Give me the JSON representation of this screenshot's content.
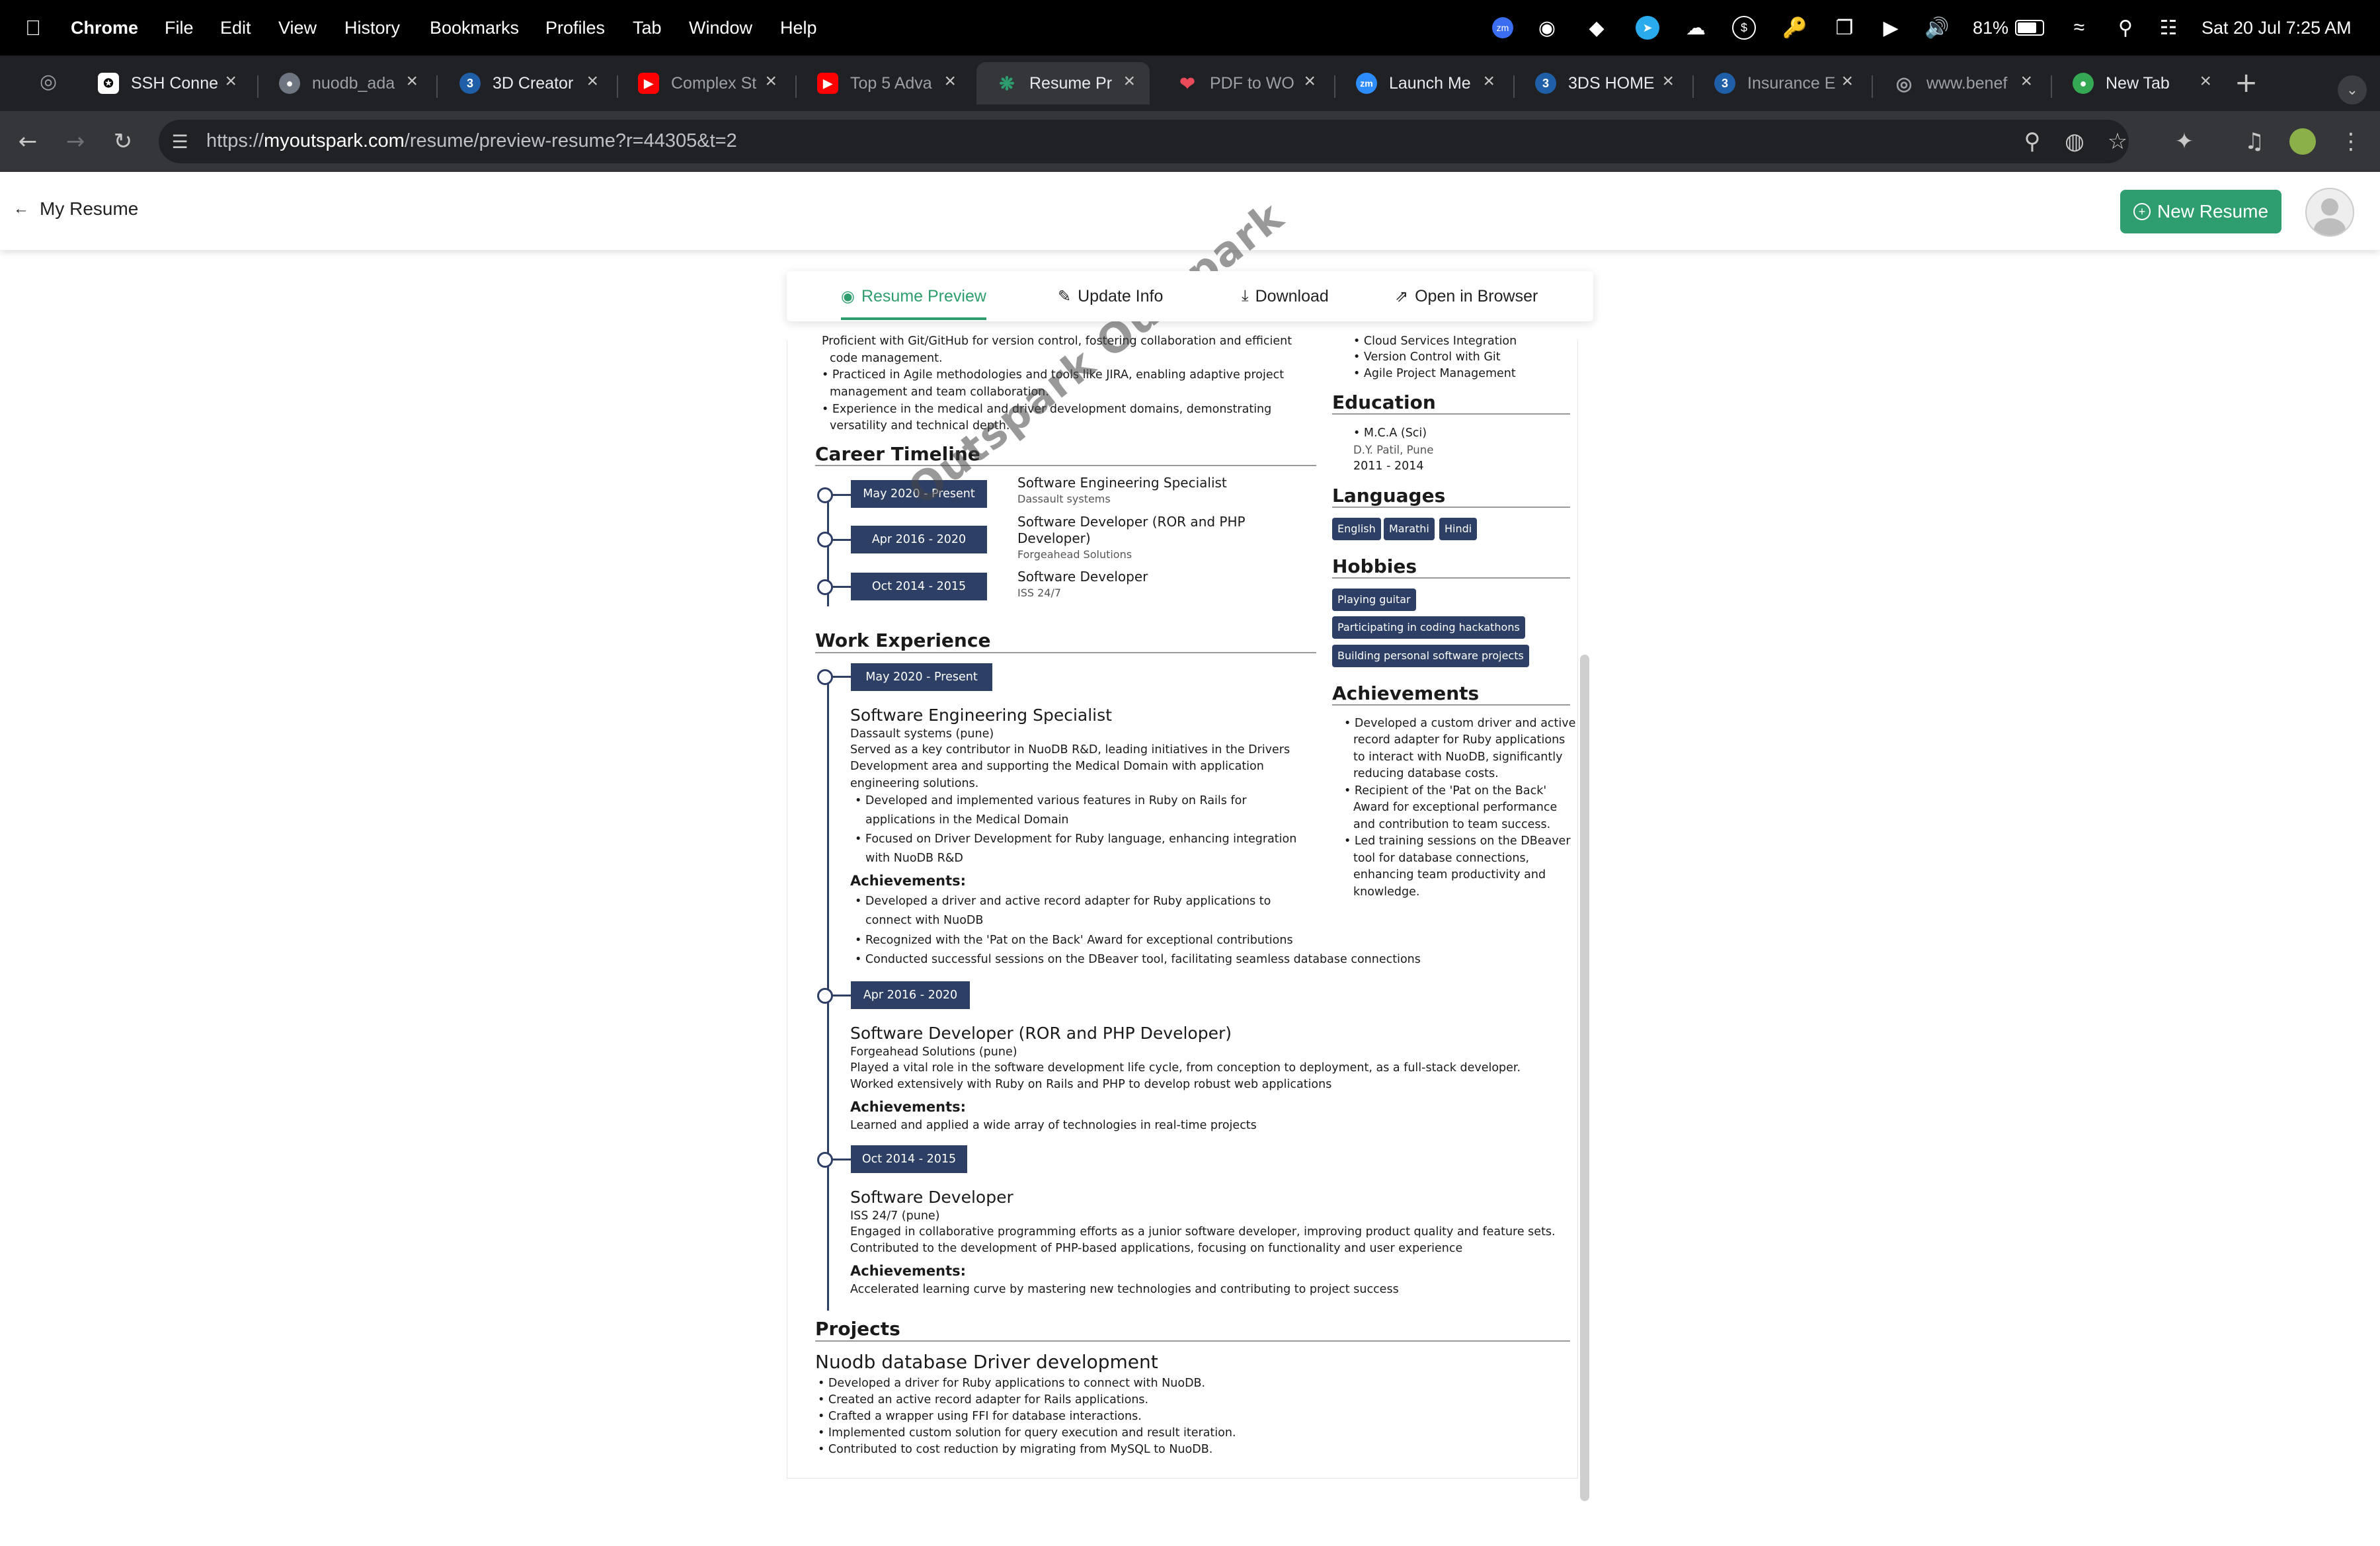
{
  "menubar": {
    "app": "Chrome",
    "items": [
      "File",
      "Edit",
      "View",
      "History",
      "Bookmarks",
      "Profiles",
      "Tab",
      "Window",
      "Help"
    ],
    "battery": "81%",
    "datetime": "Sat 20 Jul  7:25 AM"
  },
  "tabs": [
    {
      "title": "SSH Conne",
      "icon": "openai-icon",
      "color": "#ffffff"
    },
    {
      "title": "nuodb_ada",
      "icon": "github-icon",
      "color": "#6e7681"
    },
    {
      "title": "3D Creator",
      "icon": "3ds-icon",
      "color": "#1f5fa8"
    },
    {
      "title": "Complex St",
      "icon": "youtube-icon",
      "color": "#ff0000"
    },
    {
      "title": "Top 5 Adva",
      "icon": "youtube-icon",
      "color": "#ff0000"
    },
    {
      "title": "Resume Pr",
      "icon": "outspark-icon",
      "color": "#2e9e6e"
    },
    {
      "title": "PDF to WO",
      "icon": "pdf-heart-icon",
      "color": "#e94b5b"
    },
    {
      "title": "Launch Me",
      "icon": "zoom-icon",
      "color": "#2d8cff"
    },
    {
      "title": "3DS HOME",
      "icon": "3ds-icon",
      "color": "#1f5fa8"
    },
    {
      "title": "Insurance E",
      "icon": "3ds-icon",
      "color": "#1f5fa8"
    },
    {
      "title": "www.benef",
      "icon": "globe-icon",
      "color": "#9aa0a6"
    },
    {
      "title": "New Tab",
      "icon": "chrome-icon",
      "color": "#34a853"
    }
  ],
  "address": {
    "prefix": "https://",
    "host": "myoutspark.com",
    "path": "/resume/preview-resume?r=44305&t=2"
  },
  "app": {
    "back_label": "My Resume",
    "new_resume_label": "New Resume"
  },
  "actions": {
    "preview": "Resume Preview",
    "update": "Update Info",
    "download": "Download",
    "open": "Open in Browser"
  },
  "resume": {
    "watermark": "Outspark Outspark",
    "skills_tail": [
      "Proficient with Git/GitHub for version control, fostering collaboration and efficient",
      "code management.",
      "Practiced in Agile methodologies and tools like JIRA, enabling adaptive project",
      "management and team collaboration.",
      "Experience in the medical and driver development domains, demonstrating",
      "versatility and technical depth."
    ],
    "career_timeline_title": "Career Timeline",
    "timeline": [
      {
        "date": "May 2020 - Present",
        "title": "Software Engineering Specialist",
        "company": "Dassault systems"
      },
      {
        "date": "Apr 2016 - 2020",
        "title": "Software Developer (ROR and PHP",
        "title2": "Developer)",
        "company": "Forgeahead Solutions"
      },
      {
        "date": "Oct 2014 - 2015",
        "title": "Software Developer",
        "company": "ISS 24/7"
      }
    ],
    "work_title": "Work Experience",
    "jobs": [
      {
        "date": "May 2020 - Present",
        "title": "Software Engineering Specialist",
        "company": "Dassault systems (pune)",
        "summary": [
          "Served as a key contributor in NuoDB R&D, leading initiatives in the Drivers",
          "Development area and supporting the Medical Domain with application",
          "engineering solutions."
        ],
        "bullets": [
          "Developed and implemented various features in Ruby on Rails for",
          "applications in the Medical Domain",
          "Focused on Driver Development for Ruby language, enhancing integration",
          "with NuoDB R&D"
        ],
        "ach_label": "Achievements:",
        "achievements": [
          "Developed a driver and active record adapter for Ruby applications to",
          "connect with NuoDB",
          "Recognized with the 'Pat on the Back' Award for exceptional contributions",
          "Conducted successful sessions on the DBeaver tool, facilitating seamless database connections"
        ]
      },
      {
        "date": "Apr 2016 - 2020",
        "title": "Software Developer (ROR and PHP Developer)",
        "company": "Forgeahead Solutions (pune)",
        "summary": [
          "Played a vital role in the software development life cycle, from conception to deployment, as a full-stack developer.",
          "Worked extensively with Ruby on Rails and PHP to develop robust web applications"
        ],
        "ach_label": "Achievements:",
        "achievements": [
          "Learned and applied a wide array of technologies in real-time projects"
        ]
      },
      {
        "date": "Oct 2014 - 2015",
        "title": "Software Developer",
        "company": "ISS 24/7 (pune)",
        "summary": [
          "Engaged in collaborative programming efforts as a junior software developer, improving product quality and feature sets.",
          "Contributed to the development of PHP-based applications, focusing on functionality and user experience"
        ],
        "ach_label": "Achievements:",
        "achievements": [
          "Accelerated learning curve by mastering new technologies and contributing to project success"
        ]
      }
    ],
    "projects_title": "Projects",
    "project": {
      "name": "Nuodb database Driver development",
      "bullets": [
        "Developed a driver for Ruby applications to connect with NuoDB.",
        "Created an active record adapter for Rails applications.",
        "Crafted a wrapper using FFI for database interactions.",
        "Implemented custom solution for query execution and result iteration.",
        "Contributed to cost reduction by migrating from MySQL to NuoDB."
      ]
    },
    "right": {
      "skills_tail": [
        "Cloud Services Integration",
        "Version Control with Git",
        "Agile Project Management"
      ],
      "education_title": "Education",
      "education": {
        "degree": "M.C.A (Sci)",
        "school": "D.Y. Patil, Pune",
        "years": "2011 - 2014"
      },
      "languages_title": "Languages",
      "languages": [
        "English",
        "Marathi",
        "Hindi"
      ],
      "hobbies_title": "Hobbies",
      "hobbies": [
        "Playing guitar",
        "Participating in coding hackathons",
        "Building personal software projects"
      ],
      "achievements_title": "Achievements",
      "achievements": [
        "Developed a custom driver and active",
        "record adapter for Ruby applications",
        "to interact with NuoDB, significantly",
        "reducing database costs.",
        "Recipient of the 'Pat on the Back'",
        "Award for exceptional performance",
        "and contribution to team success.",
        "Led training sessions on the DBeaver",
        "tool for database connections,",
        "enhancing team productivity and",
        "knowledge."
      ]
    }
  }
}
